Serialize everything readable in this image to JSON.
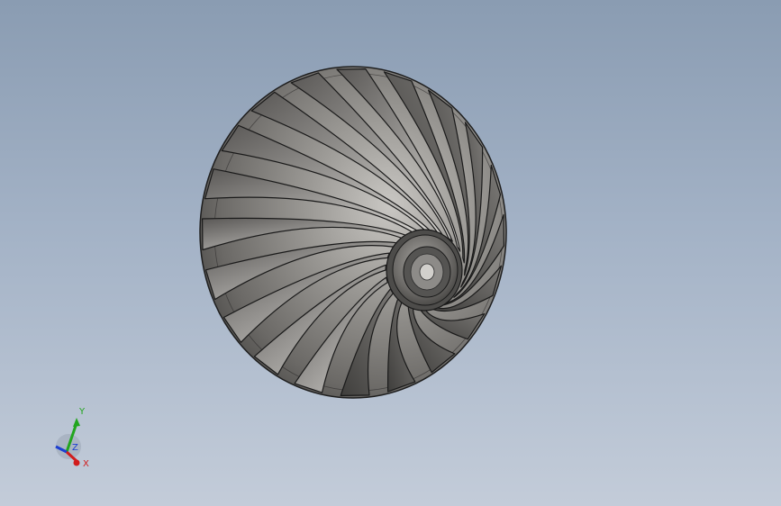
{
  "triad": {
    "x_label": "X",
    "y_label": "Y",
    "z_label": "Z",
    "x_color": "#d11c1c",
    "y_color": "#22a51e",
    "z_color": "#1c3fd1"
  },
  "model": {
    "name_icon": "impeller-3d-model",
    "blade_count_visible": 20,
    "shade_color": "#6d6b68",
    "highlight_color": "#c4c2bf",
    "edge_color": "#1e1e1e"
  }
}
